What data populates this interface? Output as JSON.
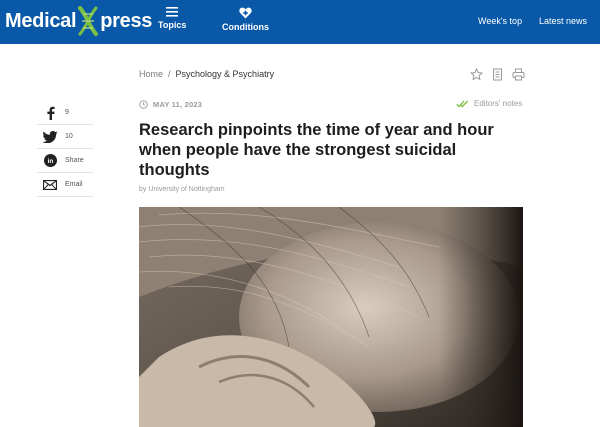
{
  "header": {
    "logo_left": "Medical",
    "logo_right": "press",
    "nav": {
      "topics": "Topics",
      "conditions": "Conditions",
      "weeks_top": "Week's top",
      "latest_news": "Latest news"
    },
    "colors": {
      "bar": "#0a59a8",
      "logo_x": "#7cc043"
    }
  },
  "breadcrumb": {
    "home": "Home",
    "separator": "/",
    "category": "Psychology & Psychiatry"
  },
  "tools": {
    "icons": [
      "star-icon",
      "print-alt-icon",
      "printer-icon"
    ]
  },
  "article": {
    "date": "MAY 11, 2023",
    "editors_notes": "Editors' notes",
    "title": "Research pinpoints the time of year and hour when people have the strongest suicidal thoughts",
    "byline": "by University of Nottingham"
  },
  "share": {
    "facebook": {
      "count": "9",
      "icon": "facebook-icon"
    },
    "twitter": {
      "count": "10",
      "icon": "twitter-icon"
    },
    "linkedin": {
      "label": "Share",
      "icon": "linkedin-icon"
    },
    "email": {
      "label": "Email",
      "icon": "email-icon"
    }
  }
}
